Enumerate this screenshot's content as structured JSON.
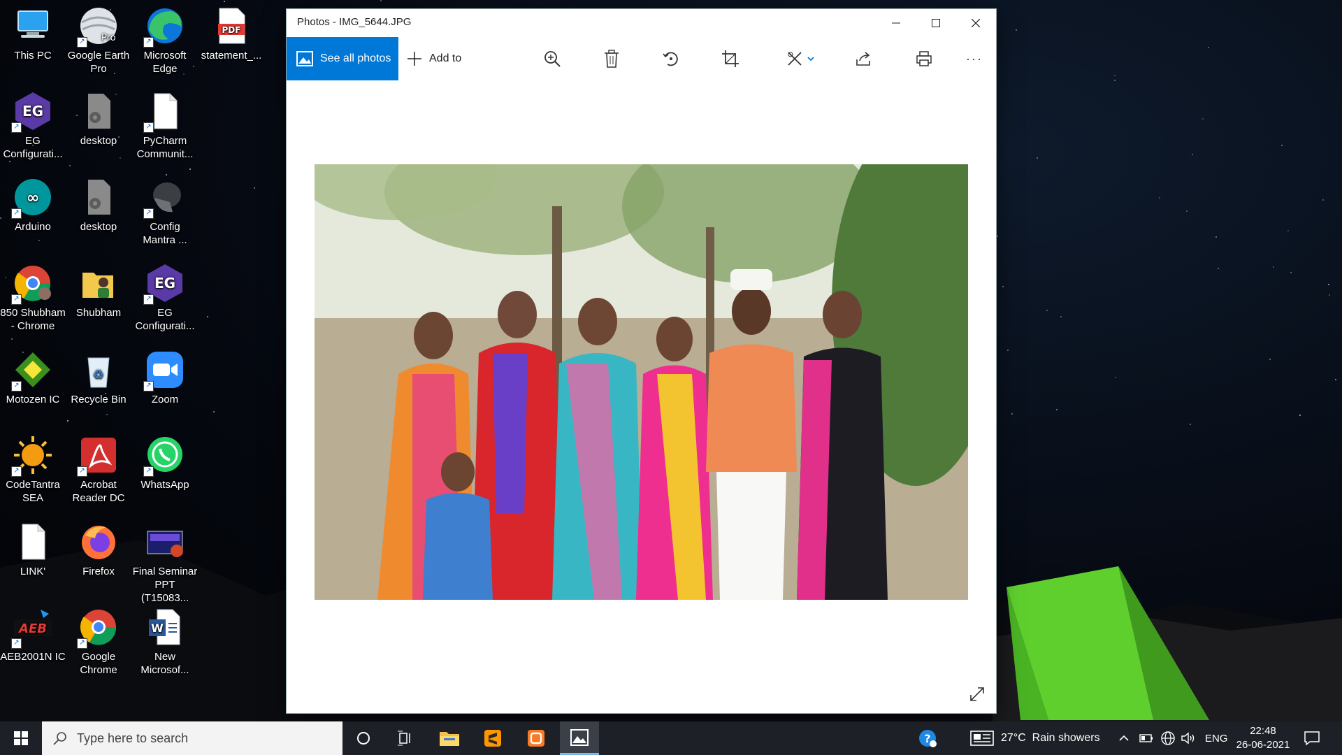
{
  "desktop": {
    "icons": [
      {
        "label": "This PC",
        "icon": "computer-icon"
      },
      {
        "label": "Google Earth Pro",
        "icon": "google-earth-icon",
        "badge": "Pro"
      },
      {
        "label": "Microsoft Edge",
        "icon": "edge-icon"
      },
      {
        "label": "statement_...",
        "icon": "pdf-file-icon",
        "badge": "PDF"
      },
      {
        "label": "EG Configurati...",
        "icon": "eg-config-icon",
        "badge": "EG"
      },
      {
        "label": "desktop",
        "icon": "settings-file-icon"
      },
      {
        "label": "PyCharm Communit...",
        "icon": "blank-file-icon"
      },
      {
        "label": "Arduino",
        "icon": "arduino-icon"
      },
      {
        "label": "desktop",
        "icon": "settings-file-icon"
      },
      {
        "label": "Config Mantra ...",
        "icon": "config-mantra-icon"
      },
      {
        "label": "850 Shubham - Chrome",
        "icon": "chrome-profile-icon"
      },
      {
        "label": "Shubham",
        "icon": "user-folder-icon"
      },
      {
        "label": "EG Configurati...",
        "icon": "eg-config-icon",
        "badge": "EG"
      },
      {
        "label": "Motozen IC",
        "icon": "motozen-icon"
      },
      {
        "label": "Recycle Bin",
        "icon": "recycle-bin-icon"
      },
      {
        "label": "Zoom",
        "icon": "zoom-icon"
      },
      {
        "label": "CodeTantra SEA",
        "icon": "codetantra-icon"
      },
      {
        "label": "Acrobat Reader DC",
        "icon": "acrobat-icon"
      },
      {
        "label": "WhatsApp",
        "icon": "whatsapp-icon"
      },
      {
        "label": "LINK'",
        "icon": "blank-file-icon"
      },
      {
        "label": "Firefox",
        "icon": "firefox-icon"
      },
      {
        "label": "Final Seminar PPT (T15083...",
        "icon": "powerpoint-file-icon"
      },
      {
        "label": "AEB2001N IC",
        "icon": "aeb-icon",
        "badge": "AEB"
      },
      {
        "label": "Google Chrome",
        "icon": "chrome-icon"
      },
      {
        "label": "New Microsof...",
        "icon": "word-file-icon",
        "badge": "W"
      }
    ]
  },
  "window": {
    "title": "Photos - IMG_5644.JPG",
    "controls": {
      "minimize": "—",
      "maximize": "☐",
      "close": "✕"
    },
    "toolbar": {
      "see_all_photos": "See all photos",
      "add_to": "Add to",
      "more": "···"
    },
    "photo": {
      "file": "IMG_5644.JPG"
    }
  },
  "taskbar": {
    "search_placeholder": "Type here to search",
    "weather": "27°C  Rain showers",
    "language": "ENG",
    "time": "22:48",
    "date": "26-06-2021"
  },
  "colors": {
    "accent": "#0078d7",
    "taskbar": "#1d2026",
    "tent": "#5fcf2e"
  }
}
